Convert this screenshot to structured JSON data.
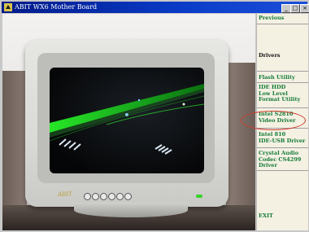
{
  "window": {
    "title": "ABIT WX6 Mother Board",
    "minimize_glyph": "_",
    "maximize_glyph": "□",
    "close_glyph": "×"
  },
  "monitor": {
    "brand_label": "ABIT"
  },
  "menu": {
    "previous": "Previous",
    "drivers": "Drivers",
    "flash_utility": "Flash Utility",
    "ide_hdd": "IDE HDD\nLow Level\nFormat Utility",
    "intel_s2810": "Intel S2810\nVideo Driver",
    "intel_810": "Intel 810\nIDE-USB Driver",
    "crystal_audio": "Crystal Audio\nCodec CS4299\nDriver",
    "exit": "EXIT"
  },
  "colors": {
    "title_gradient_start": "#001a8a",
    "menu_link": "#137a36",
    "highlight_circle": "#d23a2f"
  }
}
